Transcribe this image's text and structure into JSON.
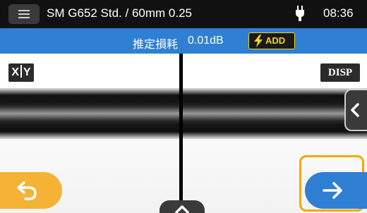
{
  "header": {
    "menu_icon": "menu-icon",
    "title": "SM G652 Std. / 60mm 0.25",
    "power_icon": "plug-icon",
    "time": "08:36"
  },
  "info_bar": {
    "loss_label": "推定損耗",
    "loss_value": "0.01dB",
    "add_icon": "lightning-bolt-icon",
    "add_label": "ADD"
  },
  "view": {
    "xy_label_x": "X",
    "xy_label_y": "Y",
    "disp_label": "DISP",
    "side_tab_icon": "chevron-left-icon",
    "bottom_tab_icon": "chevron-up-icon",
    "back_icon": "return-arrow-icon",
    "next_icon": "arrow-right-icon"
  },
  "colors": {
    "topbar": "#111111",
    "infobar": "#2f7fd3",
    "add_accent": "#f6d31a",
    "back_button": "#f5b335",
    "next_button": "#2f7fd3",
    "highlight": "#f2a900"
  }
}
